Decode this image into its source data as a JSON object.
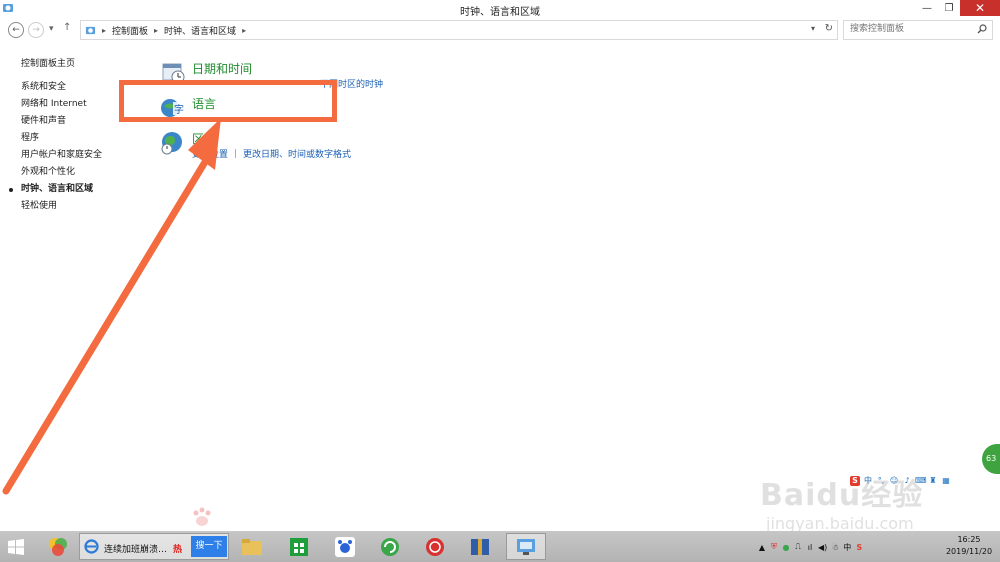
{
  "window": {
    "title": "时钟、语言和区域",
    "minimize_glyph": "—",
    "restore_glyph": "❐",
    "close_glyph": "✕"
  },
  "address": {
    "crumbs": [
      "控制面板",
      "时钟、语言和区域"
    ],
    "search_placeholder": "搜索控制面板"
  },
  "sidebar": {
    "home": "控制面板主页",
    "items": [
      "系统和安全",
      "网络和 Internet",
      "硬件和声音",
      "程序",
      "用户帐户和家庭安全",
      "外观和个性化",
      "时钟、语言和区域",
      "轻松使用"
    ],
    "current_index": 6
  },
  "categories": [
    {
      "title": "日期和时间",
      "icon": "clock-calendar-icon",
      "links": [
        "不同时区的时钟"
      ]
    },
    {
      "title": "语言",
      "icon": "language-globe-icon",
      "links": []
    },
    {
      "title": "区",
      "icon": "region-globe-icon",
      "links": [
        "更改位置",
        "更改日期、时间或数字格式"
      ]
    }
  ],
  "annotation": {
    "color": "#f36b3e"
  },
  "side_widget": {
    "label": "63"
  },
  "watermark": {
    "text": "Baidu经验",
    "url": "jingyan.baidu.com"
  },
  "taskbar": {
    "active_window_label": "连续加班崩溃…",
    "hot_label": "热",
    "search_label": "搜一下",
    "tray": {
      "ime_label": "中"
    },
    "clock": {
      "time": "16:25",
      "date": "2019/11/20"
    }
  },
  "colors": {
    "link": "#1a5fb4",
    "category_title": "#1f8c2e",
    "close_button": "#c7302b"
  }
}
